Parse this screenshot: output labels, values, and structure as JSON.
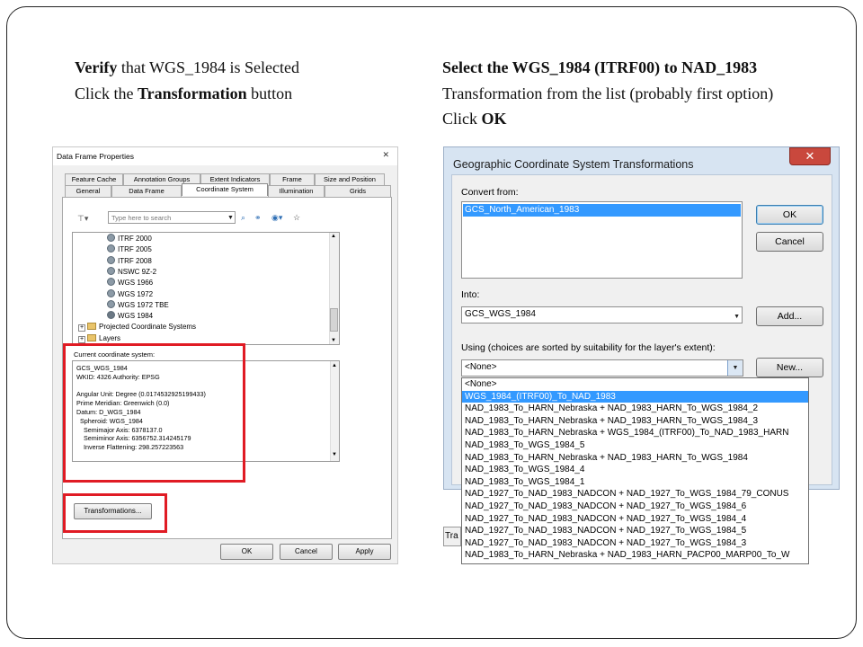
{
  "captions": {
    "left": {
      "line1_bold": "Verify",
      "line1_rest": " that WGS_1984 is Selected",
      "line2_pre": "Click the ",
      "line2_bold": "Transformation",
      "line2_post": " button"
    },
    "right": {
      "line1": "Select the WGS_1984 (ITRF00) to NAD_1983",
      "line2": "Transformation from the list (probably first option)",
      "line3_pre": "Click ",
      "line3_bold": "OK"
    }
  },
  "data_frame_properties": {
    "title": "Data Frame Properties",
    "close_icon": "close-icon",
    "tabs_back": [
      "Feature Cache",
      "Annotation Groups",
      "Extent Indicators",
      "Frame",
      "Size and Position"
    ],
    "tabs_front": [
      "General",
      "Data Frame",
      "Coordinate System",
      "Illumination",
      "Grids"
    ],
    "active_tab": "Coordinate System",
    "search_placeholder": "Type here to search",
    "tree_items": [
      "ITRF 2000",
      "ITRF 2005",
      "ITRF 2008",
      "NSWC 9Z-2",
      "WGS 1966",
      "WGS 1972",
      "WGS 1972 TBE",
      "WGS 1984"
    ],
    "tree_folders": [
      "Projected Coordinate Systems",
      "Layers"
    ],
    "current_label": "Current coordinate system:",
    "current_details": [
      "GCS_WGS_1984",
      "WKID: 4326 Authority: EPSG",
      "",
      "Angular Unit: Degree (0.0174532925199433)",
      "Prime Meridian: Greenwich (0.0)",
      "Datum: D_WGS_1984",
      "  Spheroid: WGS_1984",
      "    Semimajor Axis: 6378137.0",
      "    Semiminor Axis: 6356752.314245179",
      "    Inverse Flattening: 298.257223563"
    ],
    "transformations_button": "Transformations...",
    "ok": "OK",
    "cancel": "Cancel",
    "apply": "Apply"
  },
  "gcs_transformations": {
    "title": "Geographic Coordinate System Transformations",
    "convert_from_label": "Convert from:",
    "convert_from_item": "GCS_North_American_1983",
    "into_label": "Into:",
    "into_value": "GCS_WGS_1984",
    "using_label": "Using (choices are sorted by suitability for the layer's extent):",
    "using_value": "<None>",
    "ok": "OK",
    "cancel": "Cancel",
    "add": "Add...",
    "new": "New...",
    "peek_text": "Tra",
    "dropdown_items": [
      "<None>",
      "WGS_1984_(ITRF00)_To_NAD_1983",
      "NAD_1983_To_HARN_Nebraska + NAD_1983_HARN_To_WGS_1984_2",
      "NAD_1983_To_HARN_Nebraska + NAD_1983_HARN_To_WGS_1984_3",
      "NAD_1983_To_HARN_Nebraska + WGS_1984_(ITRF00)_To_NAD_1983_HARN",
      "NAD_1983_To_WGS_1984_5",
      "NAD_1983_To_HARN_Nebraska + NAD_1983_HARN_To_WGS_1984",
      "NAD_1983_To_WGS_1984_4",
      "NAD_1983_To_WGS_1984_1",
      "NAD_1927_To_NAD_1983_NADCON + NAD_1927_To_WGS_1984_79_CONUS",
      "NAD_1927_To_NAD_1983_NADCON + NAD_1927_To_WGS_1984_6",
      "NAD_1927_To_NAD_1983_NADCON + NAD_1927_To_WGS_1984_4",
      "NAD_1927_To_NAD_1983_NADCON + NAD_1927_To_WGS_1984_5",
      "NAD_1927_To_NAD_1983_NADCON + NAD_1927_To_WGS_1984_3",
      "NAD_1983_To_HARN_Nebraska + NAD_1983_HARN_PACP00_MARP00_To_W"
    ],
    "selected_index": 1
  },
  "colors": {
    "highlight_box": "#e01b24",
    "selection": "#3399ff"
  }
}
